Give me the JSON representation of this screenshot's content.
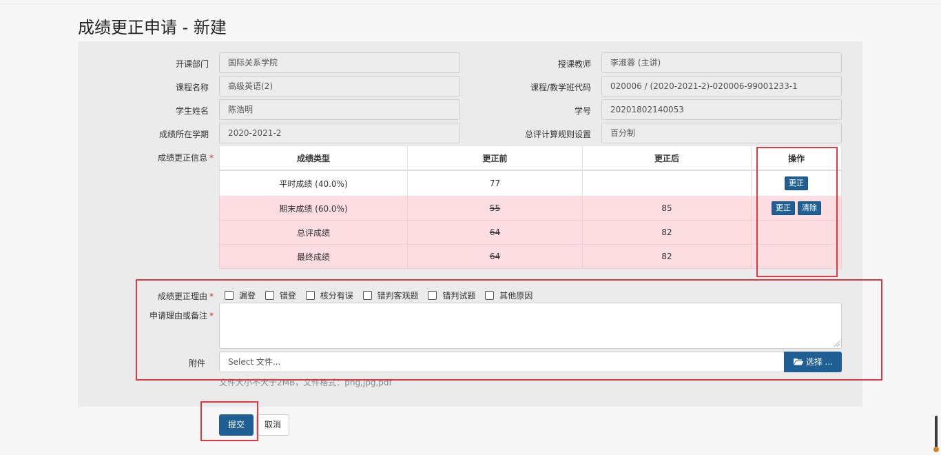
{
  "title": "成绩更正申请 - 新建",
  "fields": {
    "dept_label": "开课部门",
    "dept_value": "国际关系学院",
    "teacher_label": "授课教师",
    "teacher_value": "李淑蓉 (主讲)",
    "course_label": "课程名称",
    "course_value": "高级英语(2)",
    "code_label": "课程/教学班代码",
    "code_value": "020006 / (2020-2021-2)-020006-99001233-1",
    "student_label": "学生姓名",
    "student_value": "陈浩明",
    "sid_label": "学号",
    "sid_value": "20201802140053",
    "term_label": "成绩所在学期",
    "term_value": "2020-2021-2",
    "rule_label": "总评计算规则设置",
    "rule_value": "百分制"
  },
  "correction": {
    "label": "成绩更正信息",
    "headers": [
      "成绩类型",
      "更正前",
      "更正后",
      "操作"
    ],
    "rows": [
      {
        "type": "平时成绩 (40.0%)",
        "before": "77",
        "after": ""
      },
      {
        "type": "期末成绩 (60.0%)",
        "before": "55",
        "after": "85"
      },
      {
        "type": "总评成绩",
        "before": "64",
        "after": "82"
      },
      {
        "type": "最终成绩",
        "before": "64",
        "after": "82"
      }
    ],
    "btn_correct": "更正",
    "btn_clear": "清除"
  },
  "reason": {
    "label": "成绩更正理由",
    "options": [
      "漏登",
      "错登",
      "核分有误",
      "错判客观题",
      "错判试题",
      "其他原因"
    ],
    "note_label": "申请理由或备注"
  },
  "attachment": {
    "label": "附件",
    "placeholder": "Select 文件...",
    "button": "选择 ...",
    "hint": "文件大小不大于2MB，文件格式：png,jpg,pdf"
  },
  "actions": {
    "submit": "提交",
    "cancel": "取消"
  },
  "required_mark": "*"
}
